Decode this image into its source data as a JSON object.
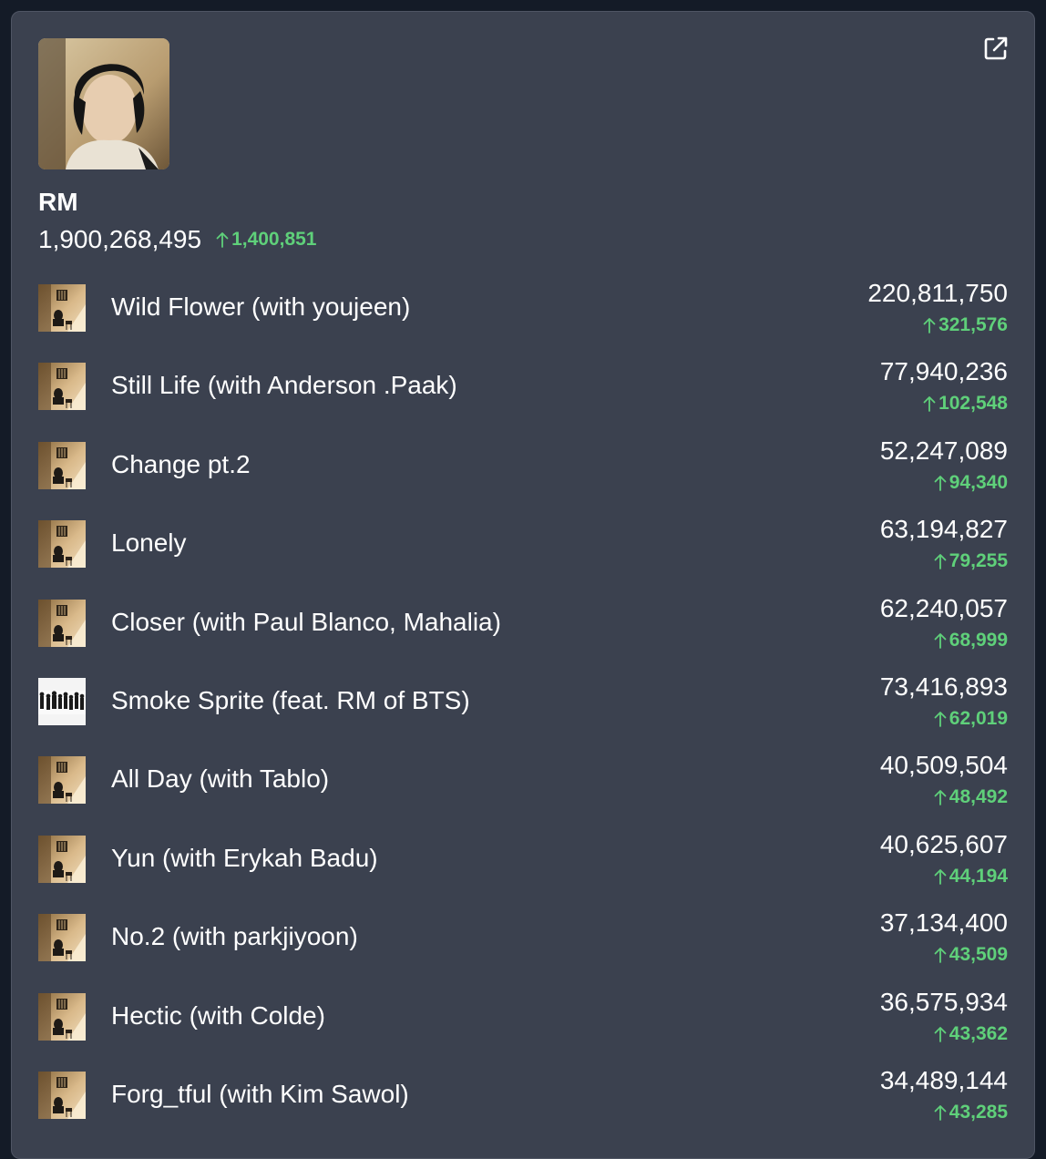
{
  "artist": {
    "name": "RM",
    "total_streams": "1,900,268,495",
    "total_delta": "1,400,851"
  },
  "icons": {
    "external_link": "external-link-icon",
    "trend": "arrow-up-icon"
  },
  "colors": {
    "background": "#141b27",
    "card": "#3b414f",
    "text": "#ffffff",
    "positive": "#5fd07a"
  },
  "tracks": [
    {
      "title": "Wild Flower (with youjeen)",
      "streams": "220,811,750",
      "delta": "321,576",
      "art": "album-rpwp"
    },
    {
      "title": "Still Life (with Anderson .Paak)",
      "streams": "77,940,236",
      "delta": "102,548",
      "art": "album-rpwp"
    },
    {
      "title": "Change pt.2",
      "streams": "52,247,089",
      "delta": "94,340",
      "art": "album-rpwp"
    },
    {
      "title": "Lonely",
      "streams": "63,194,827",
      "delta": "79,255",
      "art": "album-rpwp"
    },
    {
      "title": "Closer (with Paul Blanco, Mahalia)",
      "streams": "62,240,057",
      "delta": "68,999",
      "art": "album-rpwp"
    },
    {
      "title": "Smoke Sprite (feat. RM of BTS)",
      "streams": "73,416,893",
      "delta": "62,019",
      "art": "album-group"
    },
    {
      "title": "All Day (with Tablo)",
      "streams": "40,509,504",
      "delta": "48,492",
      "art": "album-rpwp"
    },
    {
      "title": "Yun (with Erykah Badu)",
      "streams": "40,625,607",
      "delta": "44,194",
      "art": "album-rpwp"
    },
    {
      "title": "No.2 (with parkjiyoon)",
      "streams": "37,134,400",
      "delta": "43,509",
      "art": "album-rpwp"
    },
    {
      "title": "Hectic (with Colde)",
      "streams": "36,575,934",
      "delta": "43,362",
      "art": "album-rpwp"
    },
    {
      "title": "Forg_tful (with Kim Sawol)",
      "streams": "34,489,144",
      "delta": "43,285",
      "art": "album-rpwp"
    }
  ]
}
